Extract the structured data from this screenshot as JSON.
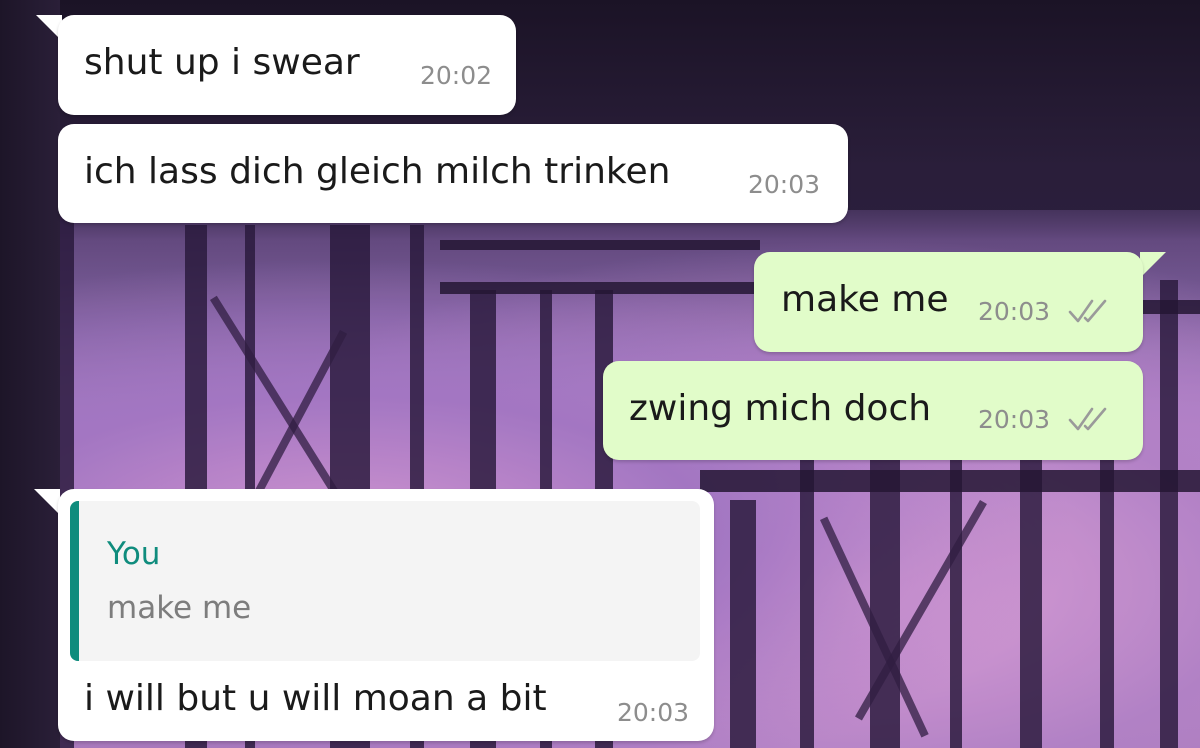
{
  "chat": {
    "messages": [
      {
        "direction": "incoming",
        "text": "shut up i swear",
        "time": "20:02"
      },
      {
        "direction": "incoming",
        "text": "ich lass dich gleich milch trinken",
        "time": "20:03"
      },
      {
        "direction": "outgoing",
        "text": "make me",
        "time": "20:03",
        "status": "read"
      },
      {
        "direction": "outgoing",
        "text": "zwing mich doch",
        "time": "20:03",
        "status": "read"
      },
      {
        "direction": "incoming",
        "quote": {
          "author": "You",
          "text": "make me"
        },
        "text": "i will but u will moan a bit",
        "time": "20:03"
      }
    ]
  },
  "icons": {
    "read_status": "double-check-icon"
  },
  "colors": {
    "incoming_bubble": "#ffffff",
    "outgoing_bubble": "#e1fcc9",
    "quote_accent": "#0f8c7d",
    "timestamp": "#8d8d8d"
  }
}
